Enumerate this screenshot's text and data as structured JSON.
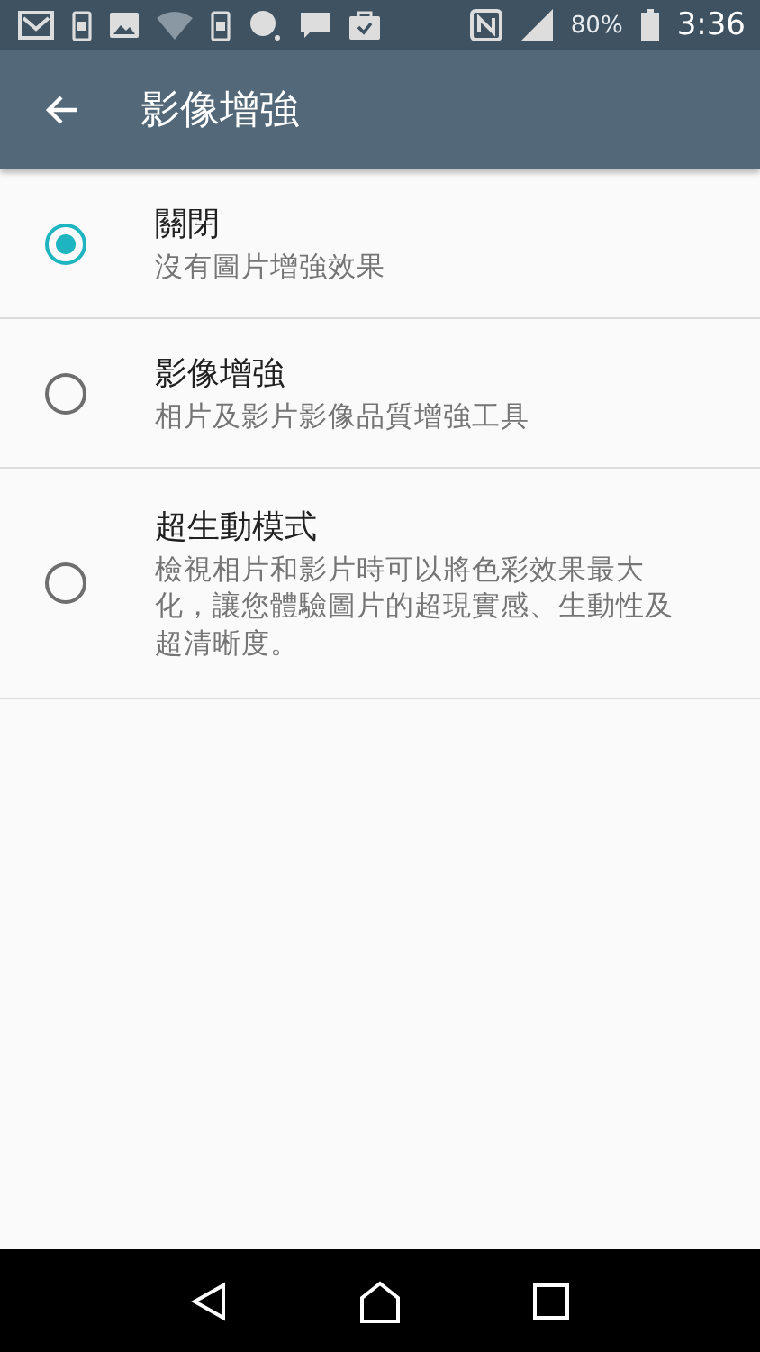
{
  "status_bar": {
    "battery": "80%",
    "time": "3:36"
  },
  "app_bar": {
    "title": "影像增強"
  },
  "options": [
    {
      "title": "關閉",
      "summary": "沒有圖片增強效果",
      "selected": true
    },
    {
      "title": "影像增強",
      "summary": "相片及影片影像品質增強工具",
      "selected": false
    },
    {
      "title": "超生動模式",
      "summary": "檢視相片和影片時可以將色彩效果最大化，讓您體驗圖片的超現實感、生動性及超清晰度。",
      "selected": false
    }
  ]
}
